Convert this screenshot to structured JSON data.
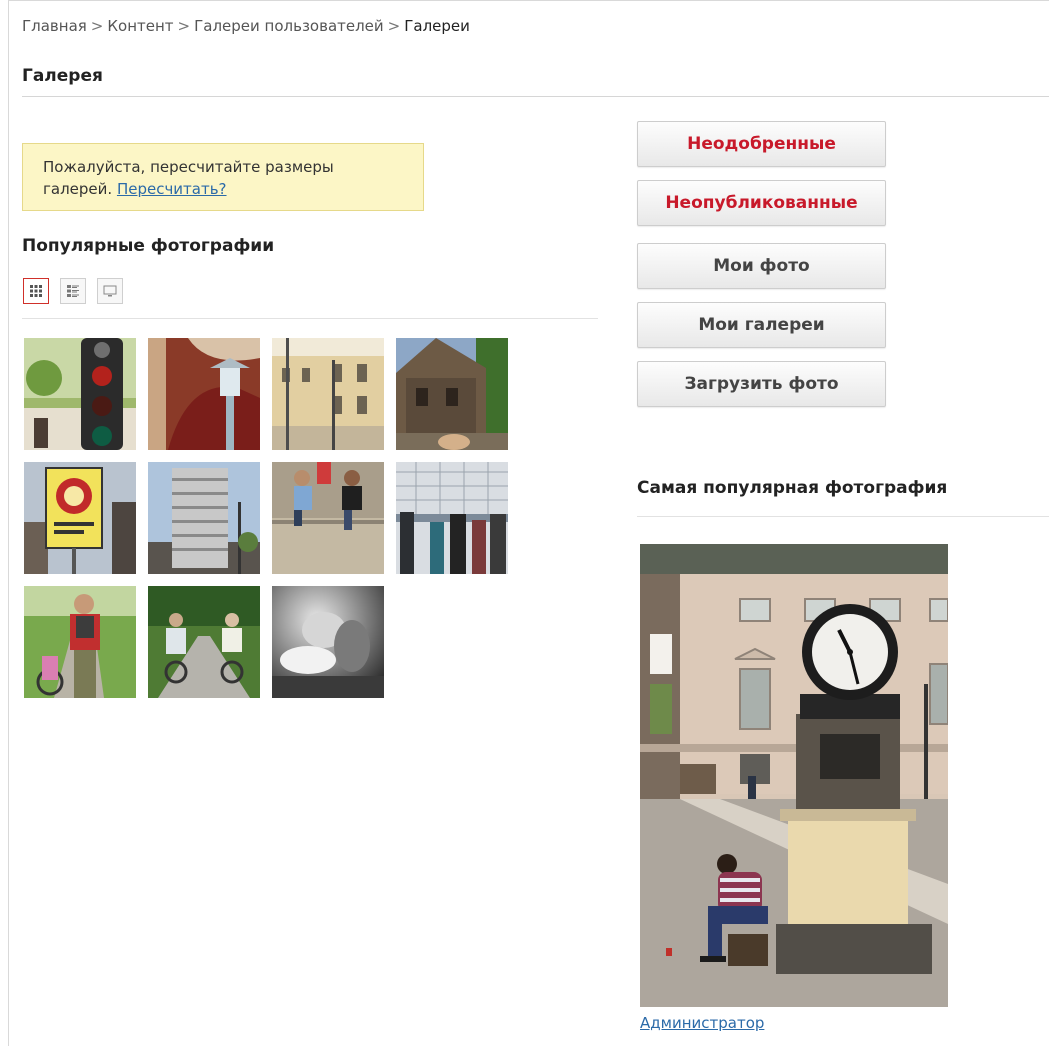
{
  "breadcrumb": {
    "items": [
      "Главная",
      "Контент",
      "Галереи пользователей"
    ],
    "current": "Галереи",
    "separator": ">"
  },
  "page": {
    "title": "Галерея"
  },
  "notice": {
    "text": "Пожалуйста, пересчитайте размеры галерей.",
    "link_label": "Пересчитать?"
  },
  "popular": {
    "title": "Популярные фотографии",
    "views": [
      {
        "name": "grid-view-icon",
        "active": true
      },
      {
        "name": "list-view-icon",
        "active": false
      },
      {
        "name": "slideshow-view-icon",
        "active": false
      }
    ],
    "photos": [
      {
        "subject": "traffic light"
      },
      {
        "subject": "lantern under arch"
      },
      {
        "subject": "street with buildings"
      },
      {
        "subject": "wooden house"
      },
      {
        "subject": "sign on pole"
      },
      {
        "subject": "stone tower"
      },
      {
        "subject": "people sitting on wall"
      },
      {
        "subject": "people at observation deck"
      },
      {
        "subject": "cyclist with backpack"
      },
      {
        "subject": "two cyclists on path"
      },
      {
        "subject": "black and white portrait"
      }
    ]
  },
  "actions": {
    "buttons": [
      {
        "label": "Неодобренные",
        "style": "red"
      },
      {
        "label": "Неопубликованные",
        "style": "red"
      },
      {
        "label": "Мои фото",
        "style": "normal"
      },
      {
        "label": "Мои галереи",
        "style": "normal"
      },
      {
        "label": "Загрузить фото",
        "style": "normal"
      }
    ]
  },
  "most_popular": {
    "title": "Самая популярная фотография",
    "author": "Администратор"
  },
  "colors": {
    "accent_red": "#c8192a",
    "link_blue": "#2b6aa8",
    "notice_bg": "#fcf6c6",
    "notice_border": "#e6d98a"
  }
}
